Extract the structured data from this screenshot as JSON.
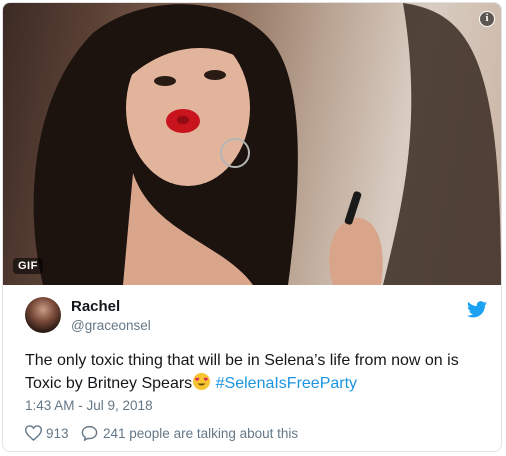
{
  "media": {
    "badge": "GIF",
    "info_icon": "info-icon"
  },
  "tweet": {
    "name": "Rachel",
    "handle": "@graceonsel",
    "text_part1": "The only toxic thing that will be in Selena’s life from now on is",
    "text_part2": "Toxic by Britney Spears",
    "emoji": "heart-eyes-emoji",
    "hashtag": "#SelenaIsFreeParty",
    "timestamp": "1:43 AM - Jul 9, 2018",
    "likes": "913",
    "conversation": "241 people are talking about this"
  },
  "colors": {
    "link": "#1b95e0",
    "secondary_text": "#657786",
    "primary_text": "#14171a",
    "twitter_blue": "#1da1f2"
  },
  "icons": {
    "brand": "twitter-bird-icon",
    "like": "heart-icon",
    "reply": "speech-bubble-icon"
  }
}
